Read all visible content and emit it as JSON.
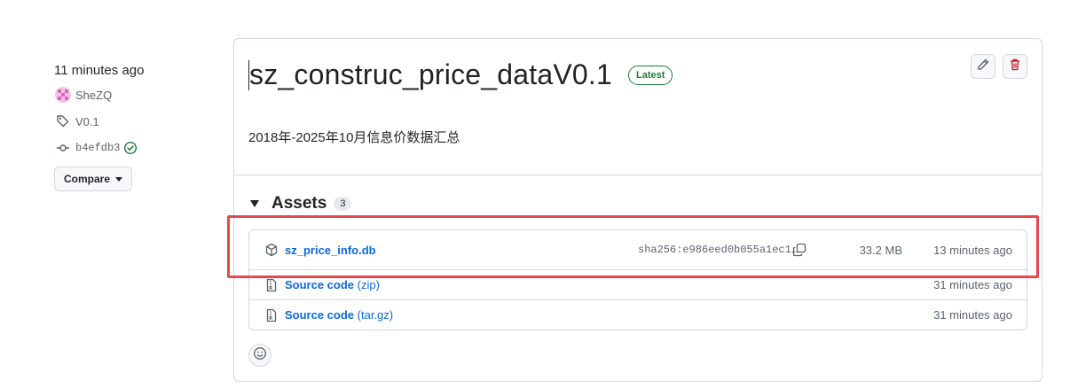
{
  "meta": {
    "time": "11 minutes ago",
    "author": "SheZQ",
    "tag": "V0.1",
    "commit": "b4efdb3",
    "compare_label": "Compare"
  },
  "release": {
    "title": "sz_construc_price_dataV0.1",
    "badge": "Latest",
    "description": "2018年-2025年10月信息价数据汇总",
    "edit_icon": "pencil-icon",
    "delete_icon": "trash-icon"
  },
  "assets": {
    "heading": "Assets",
    "count": "3",
    "items": [
      {
        "name": "sz_price_info.db",
        "sha": "sha256:e986eed0b055a1ec1…",
        "size": "33.2 MB",
        "time": "13 minutes ago",
        "icon": "package-icon"
      },
      {
        "name": "Source code",
        "suffix": "(zip)",
        "time": "31 minutes ago",
        "icon": "file-zip-icon"
      },
      {
        "name": "Source code",
        "suffix": "(tar.gz)",
        "time": "31 minutes ago",
        "icon": "file-zip-icon"
      }
    ]
  },
  "colors": {
    "link": "#0969da",
    "success": "#1a7f37",
    "danger": "#cf222e",
    "highlight": "#e5484d"
  }
}
